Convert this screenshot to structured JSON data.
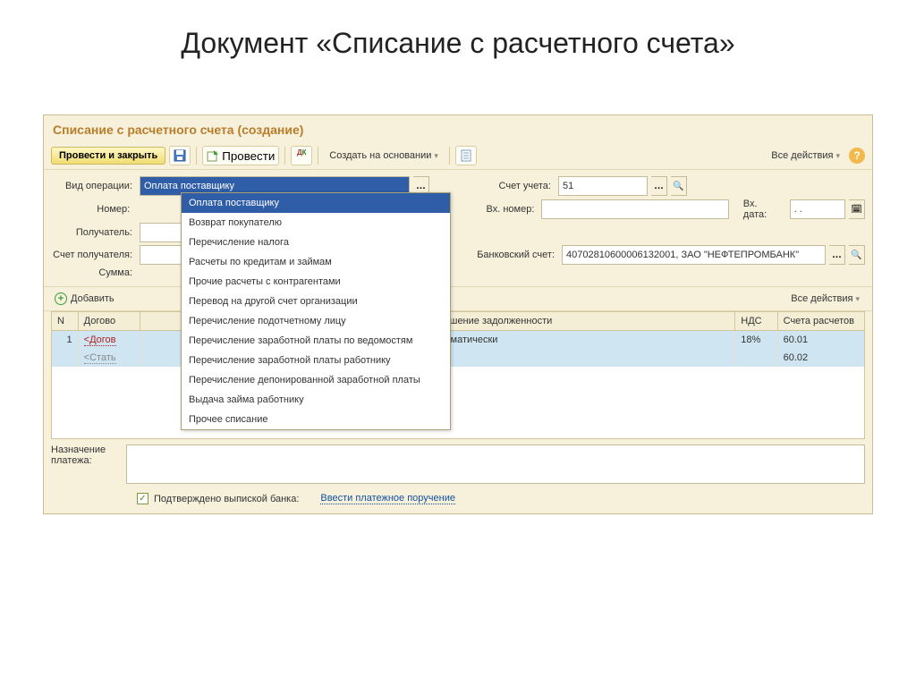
{
  "slide_title": "Документ «Списание с расчетного счета»",
  "window_title": "Списание с расчетного счета (создание)",
  "toolbar": {
    "post_close": "Провести и закрыть",
    "post": "Провести",
    "create_based": "Создать на основании",
    "all_actions": "Все действия"
  },
  "labels": {
    "operation": "Вид операции:",
    "number": "Номер:",
    "recipient": "Получатель:",
    "recipient_acc": "Счет получателя:",
    "sum": "Сумма:",
    "account": "Счет учета:",
    "in_number": "Вх. номер:",
    "in_date": "Вх. дата:",
    "bank_account": "Банковский счет:",
    "purpose": "Назначение платежа:",
    "confirmed": "Подтверждено выпиской банка:",
    "enter_pp": "Ввести платежное поручение",
    "add": "Добавить"
  },
  "fields": {
    "operation_value": "Оплата поставщику",
    "account_value": "51",
    "in_date_value": ". .",
    "bank_account_value": "40702810600006132001, ЗАО \"НЕФТЕПРОМБАНК\""
  },
  "dropdown_items": [
    "Оплата поставщику",
    "Возврат покупателю",
    "Перечисление налога",
    "Расчеты по кредитам и займам",
    "Прочие расчеты с контрагентами",
    "Перевод на другой счет организации",
    "Перечисление подотчетному лицу",
    "Перечисление заработной платы по ведомостям",
    "Перечисление заработной платы работнику",
    "Перечисление депонированной заработной платы",
    "Выдача займа работнику",
    "Прочее списание"
  ],
  "grid": {
    "headers": {
      "n": "N",
      "dogovor": "Догово",
      "pogash": "огашение задолженности",
      "nds": "НДС",
      "schet": "Счета расчетов"
    },
    "rows": [
      {
        "n": "1",
        "dogovor": "<Догов",
        "pogash": "атоматически",
        "nds": "18%",
        "schet": "60.01"
      },
      {
        "n": "",
        "dogovor": "<Стать",
        "pogash": "",
        "nds": "",
        "schet": "60.02"
      }
    ]
  }
}
